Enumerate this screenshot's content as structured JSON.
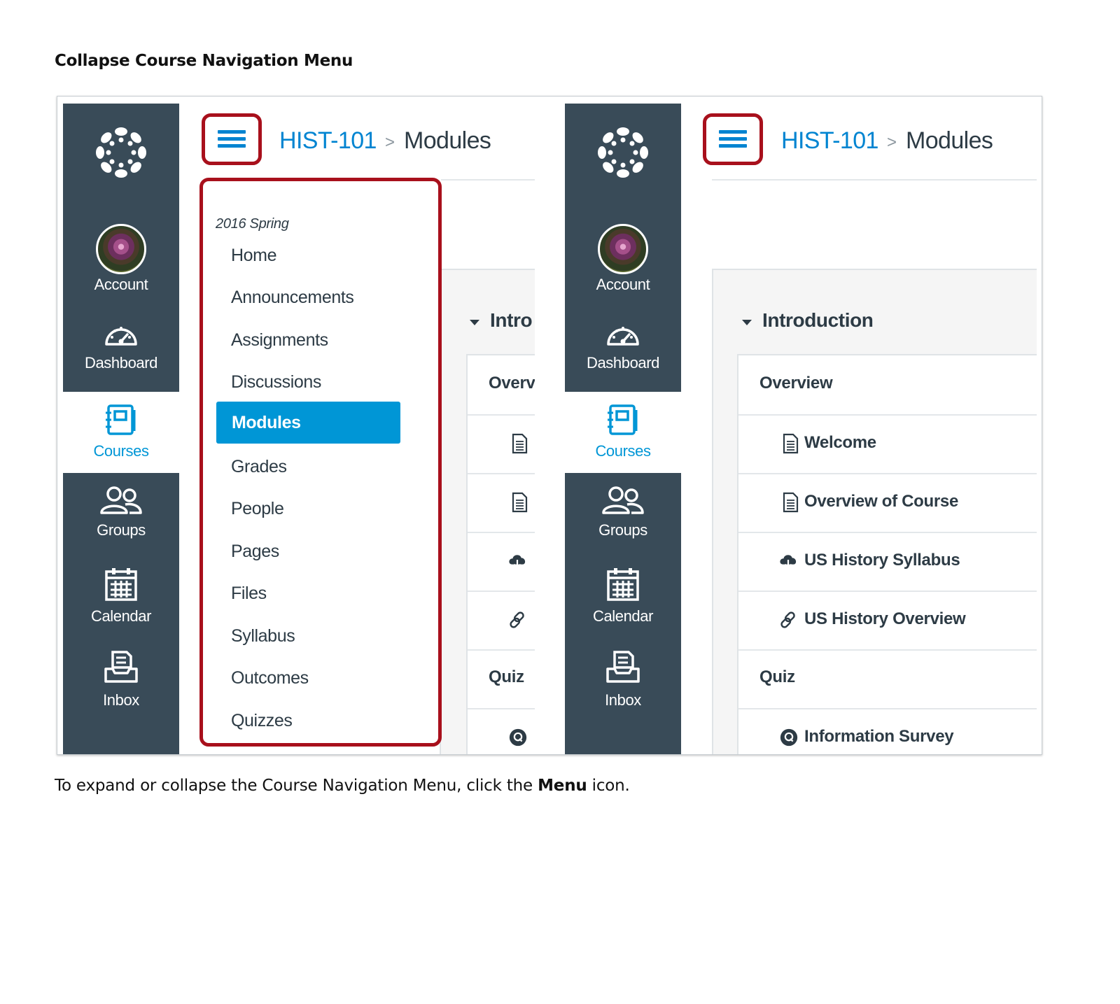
{
  "page": {
    "title": "Collapse Course Navigation Menu",
    "caption_before": "To expand or collapse the Course Navigation Menu, click the ",
    "caption_bold": "Menu",
    "caption_after": " icon."
  },
  "global_nav": {
    "items": [
      {
        "label": "Account",
        "icon": "avatar"
      },
      {
        "label": "Dashboard",
        "icon": "dashboard-icon"
      },
      {
        "label": "Courses",
        "icon": "courses-icon",
        "active": true
      },
      {
        "label": "Groups",
        "icon": "groups-icon"
      },
      {
        "label": "Calendar",
        "icon": "calendar-icon"
      },
      {
        "label": "Inbox",
        "icon": "inbox-icon"
      }
    ]
  },
  "breadcrumb": {
    "course": "HIST-101",
    "separator": ">",
    "current": "Modules"
  },
  "course_nav": {
    "term": "2016 Spring",
    "items": [
      "Home",
      "Announcements",
      "Assignments",
      "Discussions",
      "Modules",
      "Grades",
      "People",
      "Pages",
      "Files",
      "Syllabus",
      "Outcomes",
      "Quizzes"
    ],
    "active": "Modules"
  },
  "module": {
    "title": "Introduction",
    "title_truncated": "Intro",
    "overview_truncated": "Overvi",
    "rows": [
      {
        "type": "header",
        "label": "Overview"
      },
      {
        "type": "item",
        "icon": "page-icon",
        "label": "Welcome"
      },
      {
        "type": "item",
        "icon": "page-icon",
        "label": "Overview of Course"
      },
      {
        "type": "item",
        "icon": "cloud-download-icon",
        "label": "US History Syllabus"
      },
      {
        "type": "item",
        "icon": "link-icon",
        "label": "US History Overview"
      },
      {
        "type": "header",
        "label": "Quiz"
      },
      {
        "type": "item",
        "icon": "quiz-icon",
        "label": "Information Survey"
      }
    ]
  },
  "colors": {
    "global_nav_bg": "#394b58",
    "accent": "#0096d6",
    "link": "#0084d1",
    "highlight_border": "#a8101c"
  }
}
